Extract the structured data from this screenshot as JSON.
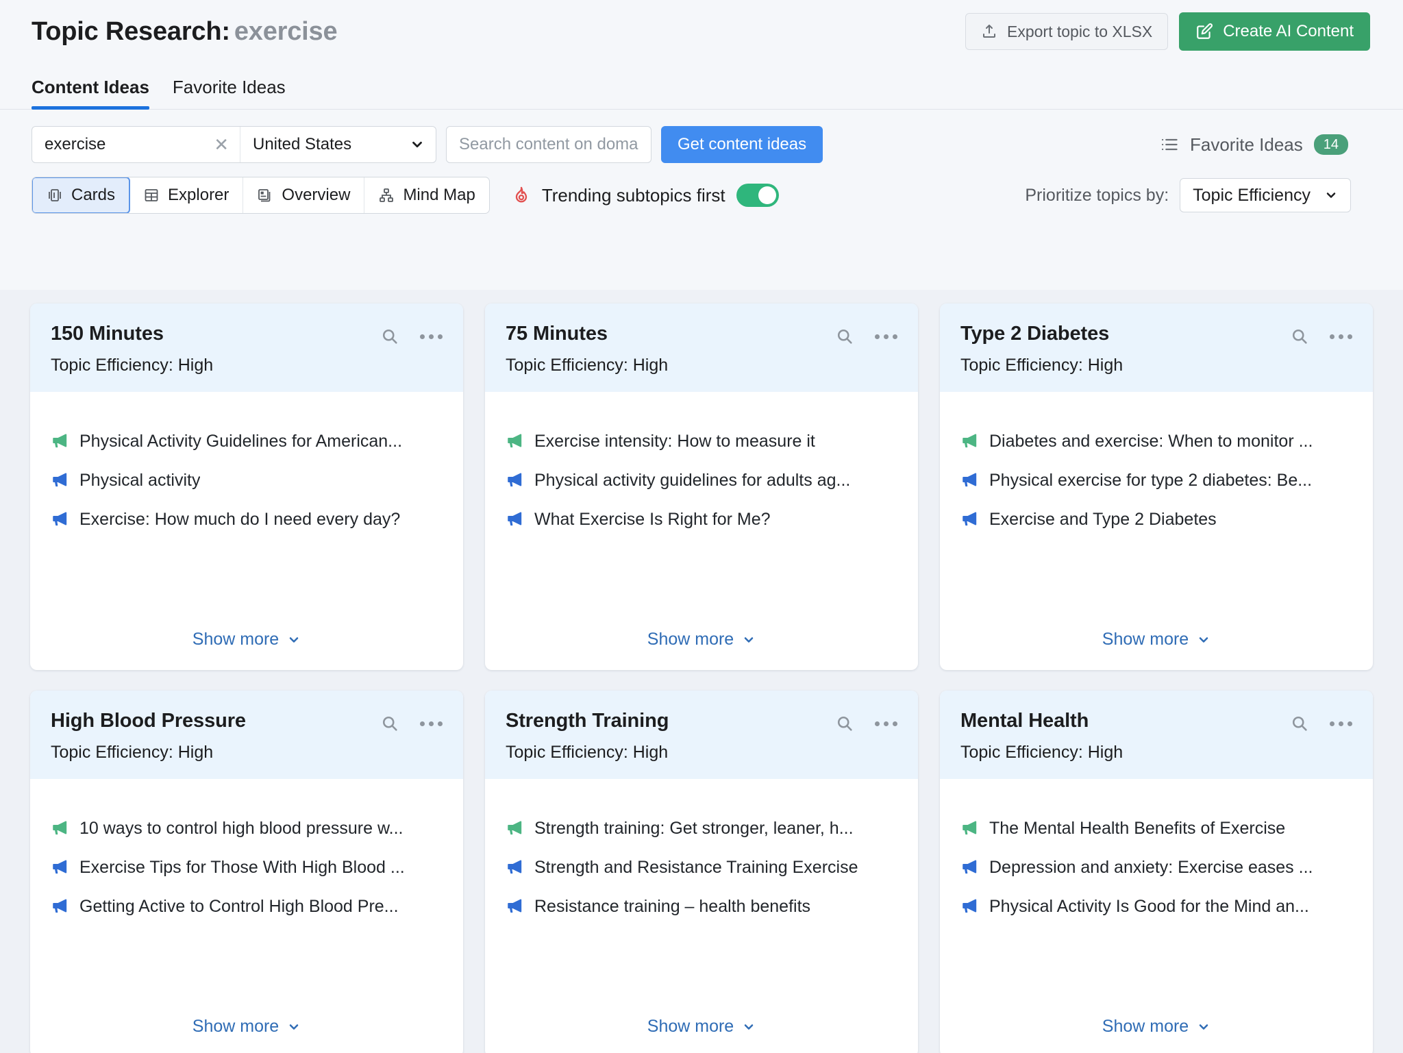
{
  "header": {
    "title_prefix": "Topic Research:",
    "keyword": "exercise",
    "export_label": "Export topic to XLSX",
    "create_ai_label": "Create AI Content",
    "export_icon": "upload-icon",
    "create_ai_icon": "edit-square-icon"
  },
  "tabs": [
    {
      "label": "Content Ideas",
      "active": true
    },
    {
      "label": "Favorite Ideas",
      "active": false
    }
  ],
  "filters": {
    "keyword_value": "exercise",
    "clear_icon": "close-icon",
    "country_value": "United States",
    "country_chevron": "chevron-down-icon",
    "domain_placeholder": "Search content on domain",
    "domain_value": "",
    "get_ideas_label": "Get content ideas",
    "favorite_ideas_label": "Favorite Ideas",
    "favorite_ideas_count": "14",
    "favorite_ideas_icon": "list-icon"
  },
  "toolbar": {
    "views": [
      {
        "label": "Cards",
        "icon": "cards-icon",
        "active": true
      },
      {
        "label": "Explorer",
        "icon": "table-icon",
        "active": false
      },
      {
        "label": "Overview",
        "icon": "overview-icon",
        "active": false
      },
      {
        "label": "Mind Map",
        "icon": "mindmap-icon",
        "active": false
      }
    ],
    "trending_label": "Trending subtopics first",
    "trending_icon": "flame-icon",
    "trending_on": true,
    "prioritize_label": "Prioritize topics by:",
    "prioritize_value": "Topic Efficiency",
    "prioritize_chevron": "chevron-down-icon"
  },
  "cards": [
    {
      "title": "150 Minutes",
      "subtitle": "Topic Efficiency: High",
      "search_icon": "search-icon",
      "menu_icon": "more-options-icon",
      "ideas": [
        {
          "text": "Physical Activity Guidelines for American...",
          "icon": "megaphone-icon",
          "color": "#4cb583"
        },
        {
          "text": "Physical activity",
          "icon": "megaphone-icon",
          "color": "#2f6cd4"
        },
        {
          "text": "Exercise: How much do I need every day?",
          "icon": "megaphone-icon",
          "color": "#2f6cd4"
        }
      ],
      "show_more_label": "Show more",
      "show_more_icon": "chevron-down-icon"
    },
    {
      "title": "75 Minutes",
      "subtitle": "Topic Efficiency: High",
      "search_icon": "search-icon",
      "menu_icon": "more-options-icon",
      "ideas": [
        {
          "text": "Exercise intensity: How to measure it",
          "icon": "megaphone-icon",
          "color": "#4cb583"
        },
        {
          "text": "Physical activity guidelines for adults ag...",
          "icon": "megaphone-icon",
          "color": "#2f6cd4"
        },
        {
          "text": "What Exercise Is Right for Me?",
          "icon": "megaphone-icon",
          "color": "#2f6cd4"
        }
      ],
      "show_more_label": "Show more",
      "show_more_icon": "chevron-down-icon"
    },
    {
      "title": "Type 2 Diabetes",
      "subtitle": "Topic Efficiency: High",
      "search_icon": "search-icon",
      "menu_icon": "more-options-icon",
      "ideas": [
        {
          "text": "Diabetes and exercise: When to monitor ...",
          "icon": "megaphone-icon",
          "color": "#4cb583"
        },
        {
          "text": "Physical exercise for type 2 diabetes: Be...",
          "icon": "megaphone-icon",
          "color": "#2f6cd4"
        },
        {
          "text": "Exercise and Type 2 Diabetes",
          "icon": "megaphone-icon",
          "color": "#2f6cd4"
        }
      ],
      "show_more_label": "Show more",
      "show_more_icon": "chevron-down-icon"
    },
    {
      "title": "High Blood Pressure",
      "subtitle": "Topic Efficiency: High",
      "search_icon": "search-icon",
      "menu_icon": "more-options-icon",
      "ideas": [
        {
          "text": "10 ways to control high blood pressure w...",
          "icon": "megaphone-icon",
          "color": "#4cb583"
        },
        {
          "text": "Exercise Tips for Those With High Blood ...",
          "icon": "megaphone-icon",
          "color": "#2f6cd4"
        },
        {
          "text": "Getting Active to Control High Blood Pre...",
          "icon": "megaphone-icon",
          "color": "#2f6cd4"
        }
      ],
      "show_more_label": "Show more",
      "show_more_icon": "chevron-down-icon"
    },
    {
      "title": "Strength Training",
      "subtitle": "Topic Efficiency: High",
      "search_icon": "search-icon",
      "menu_icon": "more-options-icon",
      "ideas": [
        {
          "text": "Strength training: Get stronger, leaner, h...",
          "icon": "megaphone-icon",
          "color": "#4cb583"
        },
        {
          "text": "Strength and Resistance Training Exercise",
          "icon": "megaphone-icon",
          "color": "#2f6cd4"
        },
        {
          "text": "Resistance training – health benefits",
          "icon": "megaphone-icon",
          "color": "#2f6cd4"
        }
      ],
      "show_more_label": "Show more",
      "show_more_icon": "chevron-down-icon"
    },
    {
      "title": "Mental Health",
      "subtitle": "Topic Efficiency: High",
      "search_icon": "search-icon",
      "menu_icon": "more-options-icon",
      "ideas": [
        {
          "text": "The Mental Health Benefits of Exercise",
          "icon": "megaphone-icon",
          "color": "#4cb583"
        },
        {
          "text": "Depression and anxiety: Exercise eases ...",
          "icon": "megaphone-icon",
          "color": "#2f6cd4"
        },
        {
          "text": "Physical Activity Is Good for the Mind an...",
          "icon": "megaphone-icon",
          "color": "#2f6cd4"
        }
      ],
      "show_more_label": "Show more",
      "show_more_icon": "chevron-down-icon"
    }
  ],
  "colors": {
    "accent_blue": "#418cf0",
    "accent_green": "#38a169",
    "toggle_green": "#2fb67c",
    "flame_red": "#e2504f",
    "tab_underline": "#1c72dd"
  }
}
